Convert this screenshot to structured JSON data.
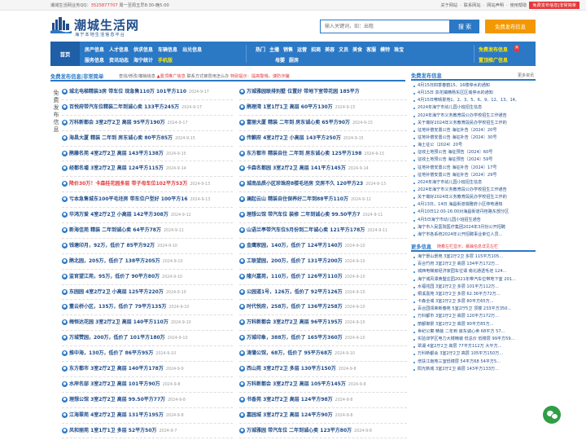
{
  "topbar": {
    "site_qq_label": "潮城生活网业务QQ：",
    "qq": "3525877707",
    "hours": " 周一至周五早8:30-晚5:00",
    "links": [
      "关于网站",
      "联系网站",
      "网站声明",
      "使用帮助"
    ],
    "publish_free": "免费发布信息|非常简单"
  },
  "header": {
    "logo_title": "潮城生活网",
    "logo_slogan": "海宁本地生活信息平台",
    "search_placeholder": "输入关键词，如：出租",
    "search_label": "搜 索",
    "publish_label": "免费发布信息"
  },
  "nav": {
    "home": "首页",
    "row1_left": [
      "房产信息",
      "人才信息",
      "供求信息",
      "车辆信息",
      "出兑信息"
    ],
    "row2_left": [
      "服务信息",
      "资讯动态",
      "海宁统计",
      "手机版"
    ],
    "row1_mid": [
      "热门",
      "主播",
      "销售",
      "运营",
      "招商",
      "美容",
      "文员",
      "美食",
      "客服",
      "模特",
      "珠宝"
    ],
    "row2_mid": [
      "母婴",
      "厨房"
    ],
    "right1": "免费发布信息",
    "right1_badge": "火",
    "right2": "置顶推广信息"
  },
  "main": {
    "title": "免费发布信息|非常简单",
    "links_text": "查找/修改/撤销信息",
    "links_red": "▲置顶推广信息",
    "links_more": "联系方式被冒用怎么办",
    "links_tip": "特别提示：提高警惕，谨防诈骗",
    "vertical_text": "免费发布信息",
    "left_items": [
      {
        "t": "城北电梯精装3房 带车位 现急售110万 101平方110",
        "d": "2024-9-17",
        "red": false
      },
      {
        "t": "百悦府带汽车位精装二年到诚心卖 133平方245万",
        "d": "2024-9-17",
        "red": false
      },
      {
        "t": "万科新都会 3室2厅2卫 高层 95平方190万",
        "d": "2024-9-17",
        "red": false
      },
      {
        "t": "海昌大厦 精装 二年到 房东诚心卖 80平方85万",
        "d": "2024-9-15",
        "red": false
      },
      {
        "t": "鹃藤名苑 4室2厅2卫 高层 143平方138万",
        "d": "2024-9-15",
        "red": false
      },
      {
        "t": "经都名墟 3室2厅2卫 高层 124平方115万",
        "d": "2024-9-14",
        "red": false
      },
      {
        "t": "降价30万！卡森桂花园多层 带子母车位102平方53万",
        "d": "2024-9-13",
        "red": true
      },
      {
        "t": "亏本急售城东100平毛坯房 带车位户型好 100平方16",
        "d": "2024-9-13",
        "red": false
      },
      {
        "t": "华鸿万爱 4室2厅2卫 小高层 142平方308万",
        "d": "2024-9-12",
        "red": false
      },
      {
        "t": "新海佳苑 精装 二年到诚心卖 64平方78万",
        "d": "2024-9-11",
        "red": false
      },
      {
        "t": "钱塘印月，92万，低价了 85平方92万",
        "d": "2024-9-10",
        "red": false
      },
      {
        "t": "鹃北园，205万，低价了 138平方205万",
        "d": "2024-9-10",
        "red": false
      },
      {
        "t": "监官望江苑，95万，低价了 90平方80万",
        "d": "2024-9-10",
        "red": false
      },
      {
        "t": "东园园 4室2厅2卫 小高层 125平方220万",
        "d": "2024-9-10",
        "red": false
      },
      {
        "t": "董云桥小区，135万，低价了 79平方135万",
        "d": "2024-9-10",
        "red": false
      },
      {
        "t": "梅恒达花园 3室2厅2卫 高层 140平方110万",
        "d": "2024-9-10",
        "red": false
      },
      {
        "t": "万城赞园，200万，低价了 101平方180万",
        "d": "2024-9-10",
        "red": false
      },
      {
        "t": "推中海，130万，低价了 86平方95万",
        "d": "2024-9-10",
        "red": false
      },
      {
        "t": "东方都市 3室2厅2卫 高层 140平方178万",
        "d": "2024-9-9",
        "red": false
      },
      {
        "t": "水岸名邸 3室2厅2卫 高层 101平方90万",
        "d": "2024-9-8",
        "red": false
      },
      {
        "t": "理想公馆 3室2厅2卫 高层 99.50平方77万",
        "d": "2024-9-8",
        "red": false
      },
      {
        "t": "江海翠苑 4室2厅2卫 高层 131平方195万",
        "d": "2024-9-8",
        "red": false
      },
      {
        "t": "风和丽苑 1室1厅1卫 多层 52平方50万",
        "d": "2024-9-7",
        "red": false
      }
    ],
    "mid_items": [
      {
        "t": "万城雅园联排别墅 位置好 带地下室带花园 185平方",
        "d": "",
        "red": false
      },
      {
        "t": "鹃理湾 1室1厅1卫 高层 60平方130万",
        "d": "2024-9-15",
        "red": false
      },
      {
        "t": "富丽大厦 精装 二年到 房东诚心卖 65平方90万",
        "d": "2024-9-15",
        "red": false
      },
      {
        "t": "传麒府 4室2厅2卫 小高层 143平方250万",
        "d": "2024-9-15",
        "red": false
      },
      {
        "t": "东方都市 精装自住 二年到 房东诚心卖 125平方198",
        "d": "2024-9-15",
        "red": false
      },
      {
        "t": "卡森名都园 3室2厅2卫 高层 141平方145万",
        "d": "2024-9-14",
        "red": false
      },
      {
        "t": "城南品质小区珍珠府8楼毛坯房 交房不久 120平方23",
        "d": "2024-9-13",
        "red": false
      },
      {
        "t": "澜起云山 精装自住保养好二年到88平方110万",
        "d": "2024-9-12",
        "red": false
      },
      {
        "t": "理想公馆 带汽车位 装修 二年到诚心卖 99.50平方7",
        "d": "2024-9-11",
        "red": false
      },
      {
        "t": "山语兰亭带汽车位5月份到二年诚心卖 121平方178万",
        "d": "2024-9-11",
        "red": false
      },
      {
        "t": "金鹰家园，140万，低价了 124平方140万",
        "d": "2024-9-10",
        "red": false
      },
      {
        "t": "工联望园，200万，低价了 131平方200万",
        "d": "2024-9-10",
        "red": false
      },
      {
        "t": "隆兴嘉苑，110万，低价了 126平方110万",
        "d": "2024-9-10",
        "red": false
      },
      {
        "t": "公园道1号，126万，低价了 92平方126万",
        "d": "2024-9-10",
        "red": false
      },
      {
        "t": "时代悦府，258万，低价了 136平方258万",
        "d": "2024-9-10",
        "red": false
      },
      {
        "t": "万科新都会 3室2厅2卫 高层 96平方195万",
        "d": "2024-9-10",
        "red": false
      },
      {
        "t": "万城印象，388万，低价了 165平方360万",
        "d": "2024-9-10",
        "red": false
      },
      {
        "t": "涛蒲公馆，68万，低价了 95平方68万",
        "d": "2024-9-10",
        "red": false
      },
      {
        "t": "西山苑 3室2厅2卫 多层 130平方150万",
        "d": "2024-9-8",
        "red": false
      },
      {
        "t": "万科新都会 3室2厅2卫 高层 105平方145万",
        "d": "2024-9-8",
        "red": false
      },
      {
        "t": "书香苑 3室2厅2卫 高层 124平方98万",
        "d": "2024-9-8",
        "red": false
      },
      {
        "t": "嘉园城 3室2厅2卫 高层 124平方90万",
        "d": "2024-9-8",
        "red": false
      },
      {
        "t": "万城雅园 带汽车位 二年到诚心卖 123平方80万",
        "d": "2024-9-8",
        "red": false
      }
    ]
  },
  "right": {
    "news_title": "免费发布信息",
    "news_more": "更多资讯",
    "news": [
      "4月15日四季春鹤15、16楼停水的通知",
      "4月15日 袁花镇横杨东区区域停水的通知",
      "4月15日嘹晴景苑1、2、3、5、6、9、12、13、14、",
      "2024年海宁市幼儿园小班招生信息",
      "2024年海宁市义务教育段公办学校招生工作通告",
      "关于做好2024年义务教育段民办学校招生工作的",
      "征地补偿安置公告 海征补告〔2024〕20号",
      "征地补偿安置公告 海征补告〔2024〕30号",
      "海土征公〔2024〕20号",
      "征收土地预公告 海征预告〔2024〕60号",
      "征收土地预公告 海征预告〔2024〕59号",
      "征地补偿安置公告 海征补告〔2024〕17号",
      "征地补偿安置公告 海征补告〔2024〕29号",
      "2024年海宁市幼儿园小班招生信息",
      "2024年海宁市义务教育段公办学校招生工作通告",
      "关于做好2024年义务教育段民办学校招生工作的",
      "4月13日，14日 海昌街道瑞雅府小区停电通知",
      "4月10日12:00-16:00对海昌街道丹桂路东部分区",
      "4月5日海宁市幼儿园小班招生通告",
      "海宁市人民医院医疗集团2024年3月份公开招聘",
      "海宁市各系统2024年公开招聘事业单位人员..."
    ],
    "more_title": "更多信息",
    "more_mid": "随着左栏显示，暴躁信息详见左栏",
    "more": [
      "海宁景山景苑 3室2厅2卫 多层 115平方105...",
      "百合竹府 3室2厅2卫 高层 134平方172万...",
      "城西电梯房经济家园车位谓 南北通透毛坯 124...",
      "海宁城风潭黄墅庄园2021年带汽车位带地下室 201...",
      "水福花园 3室2厅2卫 多层 101平方112万...",
      "桐溪嘉苑 3室2厅2卫 多层 62.36平方72万...",
      "卡森全城 3室2厅2卫 多层 80平方65万...",
      "百合园领荣新春苑 5室2厅5卫 顶楼 233平方350...",
      "万科都市 3室2厅2卫 高层 120平方172万...",
      "丽都御景 3室2厅2卫 高层 90平方85万...",
      "世纪公寓 精装 二年到 房东诚心卖 68平方 57...",
      "实验双学区电力大楼精装 低总价 低楼层 99平方59...",
      "翠湖 4室2厅2卫 高层 77平方112万 大平方...",
      "万科新都会 3室2厅2卫 高层 105平方150万...",
      "增扶江南苑三室低楼层 54平方68 54平方5...",
      "阳光新城 3室2厅2卫 高层 143平方133万..."
    ]
  }
}
